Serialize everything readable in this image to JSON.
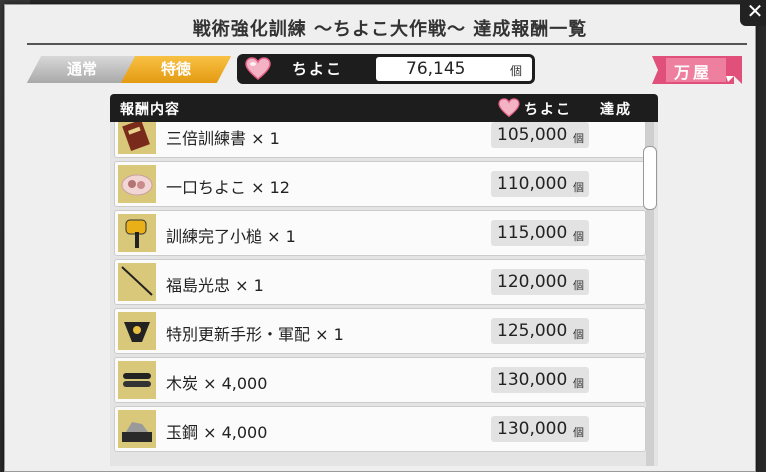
{
  "dialog": {
    "title": "戦術強化訓練 ～ちよこ大作戦～ 達成報酬一覧",
    "close": "✕"
  },
  "tabs": [
    {
      "label": "通常",
      "active": false
    },
    {
      "label": "特徳",
      "active": true
    }
  ],
  "currency": {
    "name": "ちよこ",
    "value": "76,145",
    "unit": "個",
    "icon": "heart-icon"
  },
  "shop_button": {
    "label": "万屋"
  },
  "list_header": {
    "content": "報酬内容",
    "currency": "ちよこ",
    "achieved": "達成"
  },
  "rewards": [
    {
      "name": "三倍訓練書 × 1",
      "price": "105,000",
      "unit": "個",
      "icon": "scroll-icon"
    },
    {
      "name": "一口ちよこ × 12",
      "price": "110,000",
      "unit": "個",
      "icon": "chocolate-icon"
    },
    {
      "name": "訓練完了小槌 × 1",
      "price": "115,000",
      "unit": "個",
      "icon": "mallet-icon"
    },
    {
      "name": "福島光忠 × 1",
      "price": "120,000",
      "unit": "個",
      "icon": "sword-icon"
    },
    {
      "name": "特別更新手形・軍配 × 1",
      "price": "125,000",
      "unit": "個",
      "icon": "fan-icon"
    },
    {
      "name": "木炭 × 4,000",
      "price": "130,000",
      "unit": "個",
      "icon": "charcoal-icon"
    },
    {
      "name": "玉鋼 × 4,000",
      "price": "130,000",
      "unit": "個",
      "icon": "steel-icon"
    }
  ],
  "colors": {
    "accent_gold": "#e8a21c",
    "shop_pink": "#e0507a",
    "header_dark": "#1d1d1d"
  }
}
